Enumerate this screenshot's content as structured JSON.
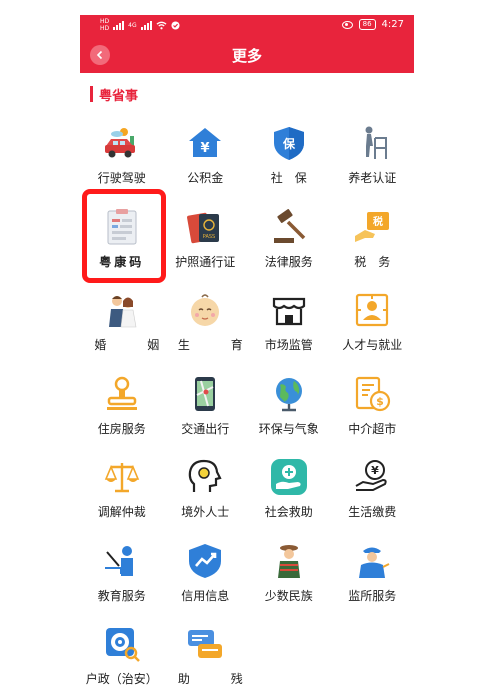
{
  "status_bar": {
    "network_top": "HD",
    "network_bottom": "HD",
    "signal_label": "4G",
    "battery": "86",
    "time": "4:27"
  },
  "header": {
    "title": "更多",
    "back_icon": "chevron-left-icon"
  },
  "section": {
    "title": "粤省事"
  },
  "colors": {
    "brand_red": "#e8243c",
    "highlight_red": "#ff1a1a"
  },
  "services": [
    {
      "label": "行驶驾驶",
      "icon": "car-icon"
    },
    {
      "label": "公积金",
      "icon": "house-fund-icon"
    },
    {
      "label": "社　保",
      "icon": "shield-insurance-icon"
    },
    {
      "label": "养老认证",
      "icon": "elderly-walker-icon"
    },
    {
      "label": "粤康码",
      "icon": "health-code-icon"
    },
    {
      "label": "护照通行证",
      "icon": "passport-icon"
    },
    {
      "label": "法律服务",
      "icon": "gavel-icon"
    },
    {
      "label": "税　务",
      "icon": "tax-hand-icon"
    },
    {
      "label": "婚　姻",
      "icon": "couple-icon"
    },
    {
      "label": "生　育",
      "icon": "baby-face-icon"
    },
    {
      "label": "市场监管",
      "icon": "storefront-icon"
    },
    {
      "label": "人才与就业",
      "icon": "id-badge-icon"
    },
    {
      "label": "住房服务",
      "icon": "stamp-icon"
    },
    {
      "label": "交通出行",
      "icon": "map-phone-icon"
    },
    {
      "label": "环保与气象",
      "icon": "globe-icon"
    },
    {
      "label": "中介超市",
      "icon": "dollar-document-icon"
    },
    {
      "label": "调解仲裁",
      "icon": "scales-icon"
    },
    {
      "label": "境外人士",
      "icon": "head-profile-icon"
    },
    {
      "label": "社会救助",
      "icon": "helping-hand-icon"
    },
    {
      "label": "生活缴费",
      "icon": "yen-hand-icon"
    },
    {
      "label": "教育服务",
      "icon": "teacher-icon"
    },
    {
      "label": "信用信息",
      "icon": "credit-shield-icon"
    },
    {
      "label": "少数民族",
      "icon": "ethnic-person-icon"
    },
    {
      "label": "监所服务",
      "icon": "officer-icon"
    },
    {
      "label": "户政（治安）",
      "icon": "target-search-icon"
    },
    {
      "label": "助　残",
      "icon": "chat-cards-icon"
    }
  ]
}
